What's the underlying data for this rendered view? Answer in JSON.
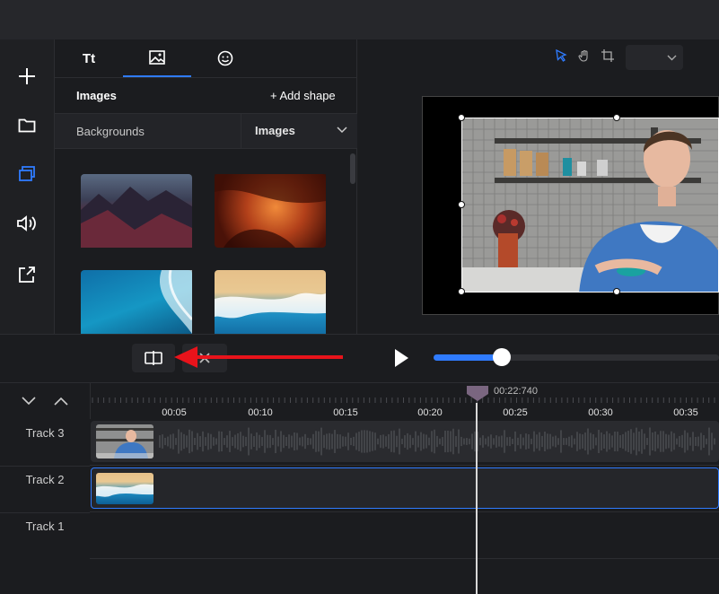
{
  "colors": {
    "accent": "#2f7bff",
    "annotation_arrow": "#e8131b",
    "playhead": "#7a6680"
  },
  "left_rail": {
    "items": [
      {
        "icon": "plus-icon"
      },
      {
        "icon": "folder-icon"
      },
      {
        "icon": "layers-icon",
        "active": true
      },
      {
        "icon": "speaker-icon"
      },
      {
        "icon": "export-icon"
      }
    ]
  },
  "panel": {
    "tabs": [
      {
        "label": "Tt",
        "icon": "text-icon"
      },
      {
        "label": "",
        "icon": "image-icon",
        "active": true
      },
      {
        "label": "",
        "icon": "sticker-icon"
      }
    ],
    "title": "Images",
    "add_shape": "+ Add shape",
    "filter_left": "Backgrounds",
    "filter_select": "Images",
    "thumbnails": [
      "mountains",
      "canyon",
      "ocean-waves",
      "beach-aerial"
    ]
  },
  "preview": {
    "toolbar": [
      "select-tool-icon",
      "hand-tool-icon",
      "crop-tool-icon"
    ],
    "zoom_select": ""
  },
  "controls": {
    "progress_fraction": 0.24
  },
  "timeline": {
    "playhead_time": "00:22:740",
    "ticks": [
      "00:05",
      "00:10",
      "00:15",
      "00:20",
      "00:25",
      "00:30",
      "00:35"
    ],
    "tracks": [
      {
        "label": "Track 3",
        "clip": "video-with-audio"
      },
      {
        "label": "Track 2",
        "clip": "beach-image",
        "selected": true
      },
      {
        "label": "Track 1",
        "clip": ""
      }
    ]
  }
}
